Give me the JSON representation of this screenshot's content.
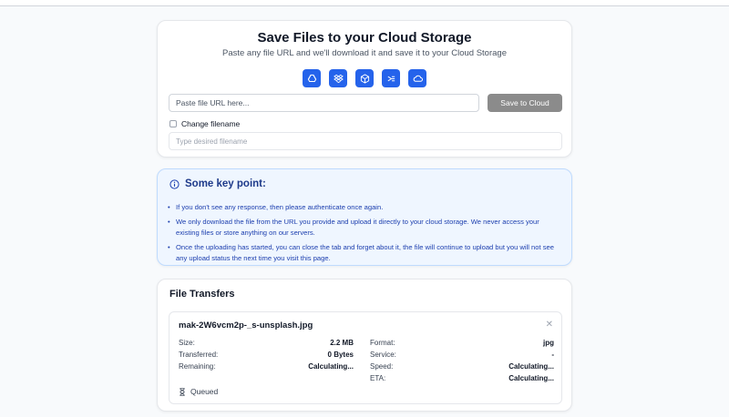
{
  "header": {
    "title": "Save Files to your Cloud Storage",
    "subtitle": "Paste any file URL and we'll download it and save it to your Cloud Storage"
  },
  "services": [
    "google-drive-icon",
    "dropbox-icon",
    "box-icon",
    "ocr-icon",
    "onedrive-icon"
  ],
  "url_input": {
    "placeholder": "Paste file URL here...",
    "value": ""
  },
  "save_button": "Save to Cloud",
  "rename": {
    "checkbox_label": "Change filename",
    "placeholder": "Type desired filename"
  },
  "key_points": {
    "title": "Some key point:",
    "items": [
      "If you don't see any response, then please authenticate once again.",
      "We only download the file from the URL you provide and upload it directly to your cloud storage. We never access your existing files or store anything on our servers.",
      "Once the uploading has started, you can close the tab and forget about it, the file will continue to upload but you will not see any upload status the next time you visit this page."
    ]
  },
  "transfers": {
    "title": "File Transfers",
    "file": {
      "name": "mak-2W6vcm2p-_s-unsplash.jpg",
      "size_label": "Size:",
      "size": "2.2 MB",
      "transferred_label": "Transferred:",
      "transferred": "0 Bytes",
      "remaining_label": "Remaining:",
      "remaining": "Calculating...",
      "format_label": "Format:",
      "format": "jpg",
      "service_label": "Service:",
      "service": "-",
      "speed_label": "Speed:",
      "speed": "Calculating...",
      "eta_label": "ETA:",
      "eta": "Calculating...",
      "status": "Queued"
    }
  },
  "colors": {
    "accent": "#2563eb",
    "save_button_bg": "#8b8b8b",
    "info_bg": "#eff6ff",
    "info_text": "#1e40af"
  }
}
